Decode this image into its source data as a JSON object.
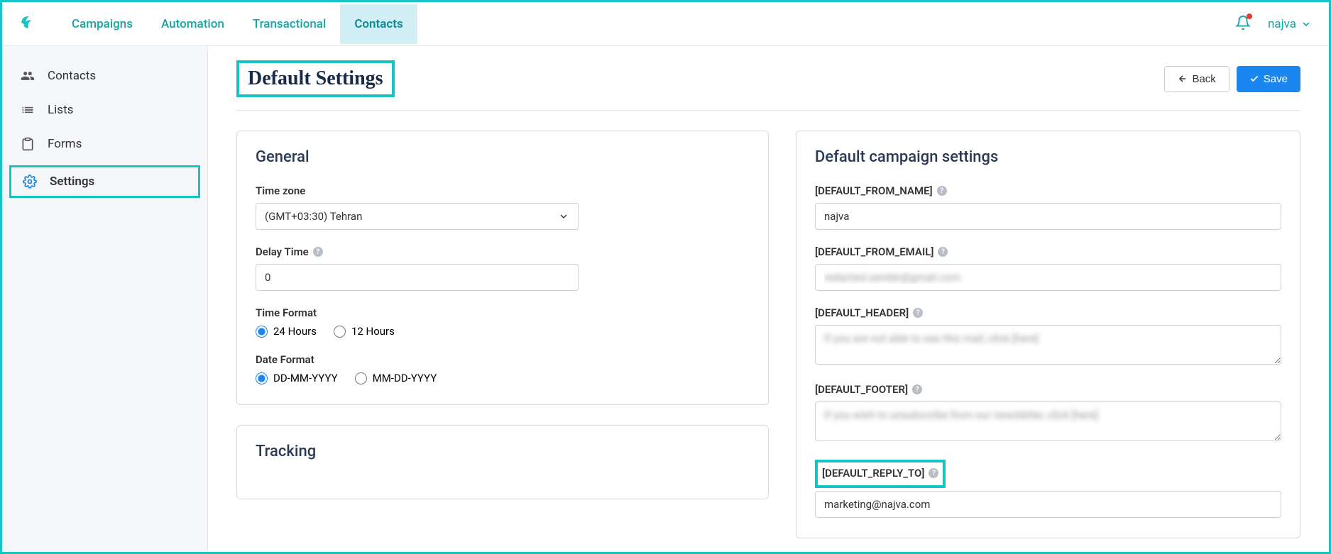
{
  "nav": {
    "campaigns": "Campaigns",
    "automation": "Automation",
    "transactional": "Transactional",
    "contacts": "Contacts"
  },
  "user": {
    "name": "najva"
  },
  "sidebar": {
    "contacts": "Contacts",
    "lists": "Lists",
    "forms": "Forms",
    "settings": "Settings"
  },
  "page": {
    "title": "Default Settings",
    "back": "Back",
    "save": "Save"
  },
  "general": {
    "heading": "General",
    "timezone_label": "Time zone",
    "timezone_value": "(GMT+03:30) Tehran",
    "delay_label": "Delay Time",
    "delay_value": "0",
    "timeformat_label": "Time Format",
    "tf_24": "24 Hours",
    "tf_12": "12 Hours",
    "dateformat_label": "Date Format",
    "df_dmy": "DD-MM-YYYY",
    "df_mdy": "MM-DD-YYYY"
  },
  "tracking": {
    "heading": "Tracking"
  },
  "campaign": {
    "heading": "Default campaign settings",
    "from_name_label": "[DEFAULT_FROM_NAME]",
    "from_name_value": "najva",
    "from_email_label": "[DEFAULT_FROM_EMAIL]",
    "from_email_value": "redacted.sender@gmail.com",
    "header_label": "[DEFAULT_HEADER]",
    "header_value": "If you are not able to see this mail, click [here]",
    "footer_label": "[DEFAULT_FOOTER]",
    "footer_value": "If you wish to unsubscribe from our newsletter, click [here]",
    "reply_to_label": "[DEFAULT_REPLY_TO]",
    "reply_to_value": "marketing@najva.com"
  }
}
